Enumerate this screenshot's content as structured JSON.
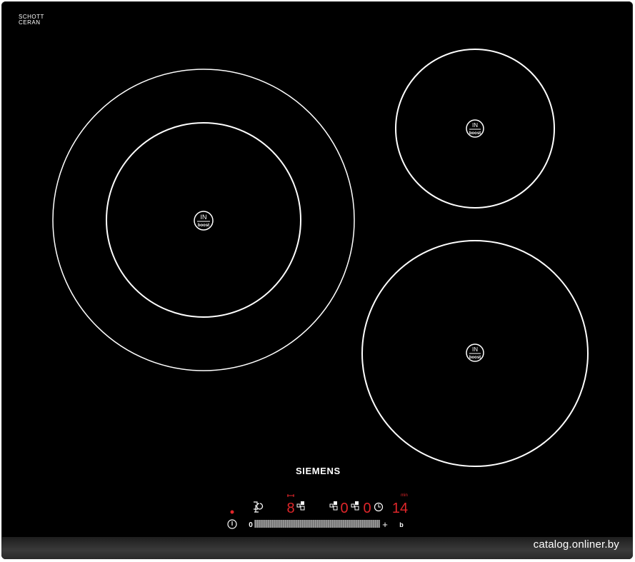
{
  "branding": {
    "glass_brand": "SCHOTT CERAN",
    "glass_brand_line1": "SCHOTT",
    "glass_brand_line2": "CERAN",
    "manufacturer": "SIEMENS",
    "watermark": "catalog.onliner.by"
  },
  "zones": [
    {
      "name": "large-dual-zone",
      "badge_top": "IN",
      "badge_bottom": "boost"
    },
    {
      "name": "small-zone",
      "badge_top": "IN",
      "badge_bottom": "boost"
    },
    {
      "name": "medium-zone",
      "badge_top": "IN",
      "badge_bottom": "boost"
    }
  ],
  "control_panel": {
    "digits_zone": "8",
    "digit_a": "0",
    "digit_b": "0",
    "timer_display": "14",
    "timer_unit": "min",
    "slider_min": "0",
    "slider_plus": "+",
    "b_label": "b",
    "colors": {
      "led_red": "#e0262a",
      "symbol_white": "#ffffff",
      "slider_grey": "#8a8a8a"
    }
  }
}
